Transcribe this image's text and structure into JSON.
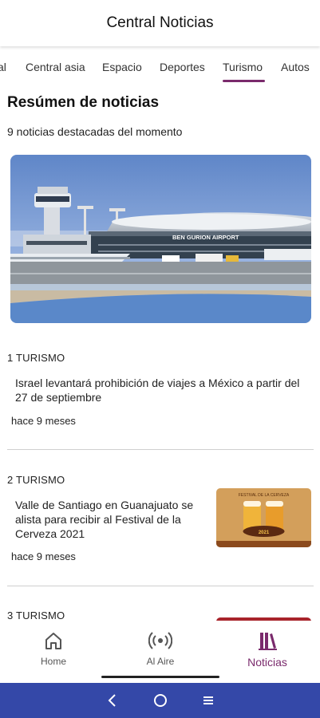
{
  "app": {
    "title": "Central Noticias"
  },
  "tabs": [
    {
      "label": "al"
    },
    {
      "label": "Central asia"
    },
    {
      "label": "Espacio"
    },
    {
      "label": "Deportes"
    },
    {
      "label": "Turismo",
      "active": true
    },
    {
      "label": "Autos"
    }
  ],
  "summary": {
    "title": "Resúmen de noticias",
    "subtitle": "9 noticias destacadas del momento"
  },
  "hero": {
    "sign_text": "BEN GURION AIRPORT"
  },
  "news": [
    {
      "category": "1 TURISMO",
      "headline": "Israel levantará prohibición de viajes a México a partir del 27 de septiembre",
      "time": "hace 9 meses"
    },
    {
      "category": "2 TURISMO",
      "headline": "Valle de Santiago en Guanajuato se alista para recibir al Festival de la Cerveza 2021",
      "time": "hace 9 meses",
      "thumb_text": "FESTIVAL DE LA CERVEZA"
    },
    {
      "category": "3 TURISMO"
    }
  ],
  "bottom_nav": [
    {
      "label": "Home",
      "icon": "home-icon"
    },
    {
      "label": "Al Aire",
      "icon": "broadcast-icon"
    },
    {
      "label": "Noticias",
      "icon": "library-icon",
      "active": true
    }
  ],
  "system_nav": {
    "icons": [
      "back-icon",
      "home-circle-icon",
      "menu-icon"
    ]
  },
  "colors": {
    "accent": "#7a2a6c",
    "system_bar": "#3448a8"
  }
}
